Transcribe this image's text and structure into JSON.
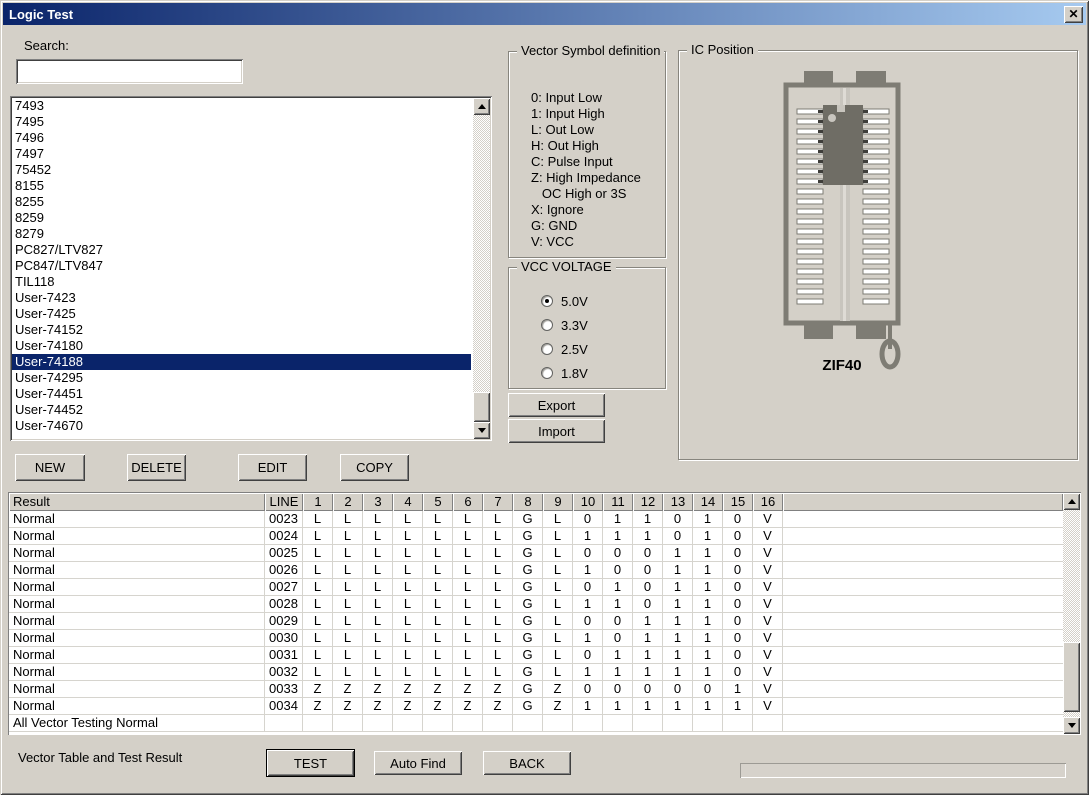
{
  "window": {
    "title": "Logic Test",
    "close_glyph": "✕"
  },
  "search": {
    "label": "Search:",
    "value": ""
  },
  "ic_list": {
    "items": [
      "7493",
      "7495",
      "7496",
      "7497",
      "75452",
      "8155",
      "8255",
      "8259",
      "8279",
      "PC827/LTV827",
      "PC847/LTV847",
      "TIL118",
      "User-7423",
      "User-7425",
      "User-74152",
      "User-74180",
      "User-74188",
      "User-74295",
      "User-74451",
      "User-74452",
      "User-74670"
    ],
    "selected": "User-74188"
  },
  "actions": {
    "new": "NEW",
    "delete": "DELETE",
    "edit": "EDIT",
    "copy": "COPY"
  },
  "vector_symbols": {
    "title": "Vector Symbol definition",
    "lines": [
      "0: Input Low",
      "1: Input High",
      "L: Out Low",
      "H: Out High",
      "C: Pulse Input",
      "Z: High Impedance",
      "   OC High or 3S",
      "X: Ignore",
      "G: GND",
      "V: VCC"
    ]
  },
  "vcc_voltage": {
    "title": "VCC VOLTAGE",
    "options": [
      {
        "label": "5.0V",
        "selected": true
      },
      {
        "label": "3.3V",
        "selected": false
      },
      {
        "label": "2.5V",
        "selected": false
      },
      {
        "label": "1.8V",
        "selected": false
      }
    ]
  },
  "transfer": {
    "export": "Export",
    "import": "Import"
  },
  "ic_position": {
    "title": "IC Position",
    "socket_label": "ZIF40",
    "pins_per_side": 20,
    "chip_pin_rows": 8
  },
  "result_table": {
    "columns": [
      "Result",
      "LINE",
      "1",
      "2",
      "3",
      "4",
      "5",
      "6",
      "7",
      "8",
      "9",
      "10",
      "11",
      "12",
      "13",
      "14",
      "15",
      "16"
    ],
    "rows": [
      {
        "result": "Normal",
        "line": "0023",
        "pins": [
          "L",
          "L",
          "L",
          "L",
          "L",
          "L",
          "L",
          "G",
          "L",
          "0",
          "1",
          "1",
          "0",
          "1",
          "0",
          "V"
        ]
      },
      {
        "result": "Normal",
        "line": "0024",
        "pins": [
          "L",
          "L",
          "L",
          "L",
          "L",
          "L",
          "L",
          "G",
          "L",
          "1",
          "1",
          "1",
          "0",
          "1",
          "0",
          "V"
        ]
      },
      {
        "result": "Normal",
        "line": "0025",
        "pins": [
          "L",
          "L",
          "L",
          "L",
          "L",
          "L",
          "L",
          "G",
          "L",
          "0",
          "0",
          "0",
          "1",
          "1",
          "0",
          "V"
        ]
      },
      {
        "result": "Normal",
        "line": "0026",
        "pins": [
          "L",
          "L",
          "L",
          "L",
          "L",
          "L",
          "L",
          "G",
          "L",
          "1",
          "0",
          "0",
          "1",
          "1",
          "0",
          "V"
        ]
      },
      {
        "result": "Normal",
        "line": "0027",
        "pins": [
          "L",
          "L",
          "L",
          "L",
          "L",
          "L",
          "L",
          "G",
          "L",
          "0",
          "1",
          "0",
          "1",
          "1",
          "0",
          "V"
        ]
      },
      {
        "result": "Normal",
        "line": "0028",
        "pins": [
          "L",
          "L",
          "L",
          "L",
          "L",
          "L",
          "L",
          "G",
          "L",
          "1",
          "1",
          "0",
          "1",
          "1",
          "0",
          "V"
        ]
      },
      {
        "result": "Normal",
        "line": "0029",
        "pins": [
          "L",
          "L",
          "L",
          "L",
          "L",
          "L",
          "L",
          "G",
          "L",
          "0",
          "0",
          "1",
          "1",
          "1",
          "0",
          "V"
        ]
      },
      {
        "result": "Normal",
        "line": "0030",
        "pins": [
          "L",
          "L",
          "L",
          "L",
          "L",
          "L",
          "L",
          "G",
          "L",
          "1",
          "0",
          "1",
          "1",
          "1",
          "0",
          "V"
        ]
      },
      {
        "result": "Normal",
        "line": "0031",
        "pins": [
          "L",
          "L",
          "L",
          "L",
          "L",
          "L",
          "L",
          "G",
          "L",
          "0",
          "1",
          "1",
          "1",
          "1",
          "0",
          "V"
        ]
      },
      {
        "result": "Normal",
        "line": "0032",
        "pins": [
          "L",
          "L",
          "L",
          "L",
          "L",
          "L",
          "L",
          "G",
          "L",
          "1",
          "1",
          "1",
          "1",
          "1",
          "0",
          "V"
        ]
      },
      {
        "result": "Normal",
        "line": "0033",
        "pins": [
          "Z",
          "Z",
          "Z",
          "Z",
          "Z",
          "Z",
          "Z",
          "G",
          "Z",
          "0",
          "0",
          "0",
          "0",
          "0",
          "1",
          "V"
        ]
      },
      {
        "result": "Normal",
        "line": "0034",
        "pins": [
          "Z",
          "Z",
          "Z",
          "Z",
          "Z",
          "Z",
          "Z",
          "G",
          "Z",
          "1",
          "1",
          "1",
          "1",
          "1",
          "1",
          "V"
        ]
      }
    ],
    "footer": "All Vector Testing Normal"
  },
  "footer_bar": {
    "label": "Vector Table and Test Result",
    "test": "TEST",
    "auto_find": "Auto Find",
    "back": "BACK"
  },
  "colors": {
    "dialog_bg": "#D4D0C8",
    "title_gradient_start": "#0A246A",
    "title_gradient_end": "#A6CAF0",
    "selection_bg": "#0A246A",
    "selection_text": "#FFFFFF",
    "socket_gray": "#7E7C74",
    "chip_gray": "#6F6D65"
  }
}
